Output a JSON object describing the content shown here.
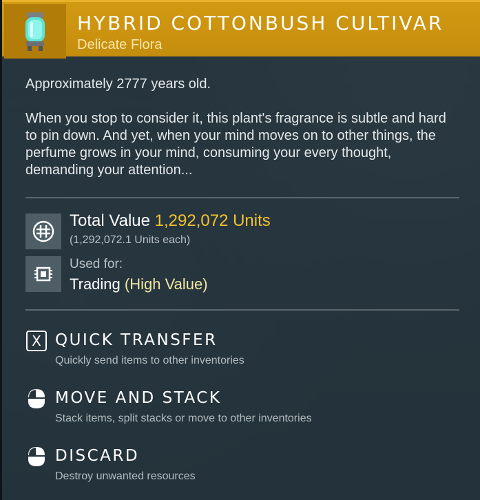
{
  "item": {
    "title": "HYBRID COTTONBUSH CULTIVAR",
    "subtitle": "Delicate Flora",
    "age_prefix": "Approximately ",
    "age_value": "2777",
    "age_suffix": " years old.",
    "description": "When you stop to consider it, this plant's fragrance is subtle and hard to pin down. And yet, when your mind moves on to other things, the perfume grows in your mind, consuming your every thought, demanding your attention..."
  },
  "value": {
    "label": "Total Value",
    "amount": "1,292,072 Units",
    "each": "(1,292,072.1 Units each)"
  },
  "usage": {
    "label": "Used for:",
    "value": "Trading",
    "qualifier": "(High Value)"
  },
  "actions": [
    {
      "title": "QUICK TRANSFER",
      "subtitle": "Quickly send items to other inventories",
      "icon": "x-key-icon"
    },
    {
      "title": "MOVE AND STACK",
      "subtitle": "Stack items, split stacks or move to other inventories",
      "icon": "mouse-left-click-icon"
    },
    {
      "title": "DISCARD",
      "subtitle": "Destroy unwanted resources",
      "icon": "mouse-left-click-icon"
    }
  ],
  "colors": {
    "header": "#c58d0d",
    "value_accent": "#f4c22c",
    "high_value": "#f2e6a2"
  }
}
